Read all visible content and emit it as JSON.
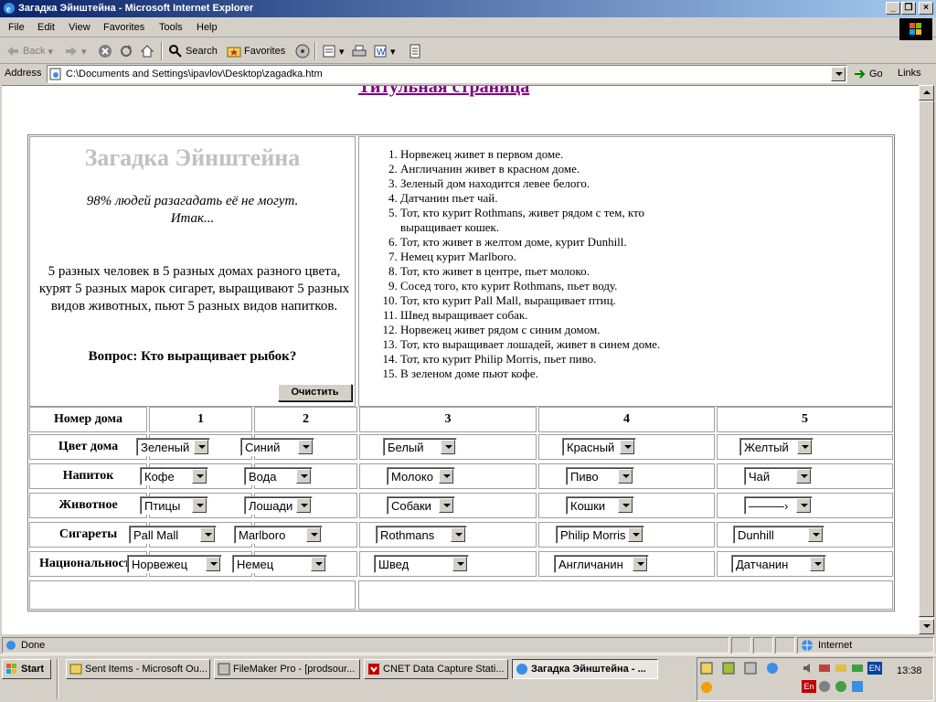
{
  "window": {
    "title": "Загадка Эйнштейна - Microsoft Internet Explorer"
  },
  "menu": [
    "File",
    "Edit",
    "View",
    "Favorites",
    "Tools",
    "Help"
  ],
  "toolbar": {
    "back": "Back",
    "search": "Search",
    "favorites": "Favorites"
  },
  "address": {
    "label": "Address",
    "url": "C:\\Documents and Settings\\ipavlov\\Desktop\\zagadka.htm",
    "go": "Go",
    "links": "Links"
  },
  "page": {
    "title_link": "Титульная страница",
    "heading": "Загадка Эйнштейна",
    "tagline1": "98% людей разагадать её не могут.",
    "tagline2": "Итак...",
    "description": "5 разных человек в 5 разных домах разного цвета, курят 5 разных марок сигарет, выращивают 5 разных видов животных, пьют 5 разных видов напитков.",
    "question": "Вопрос: Кто выращивает рыбок?",
    "clear_button": "Очистить",
    "rules": [
      "Норвежец живет в первом доме.",
      "Англичанин живет в красном доме.",
      "Зеленый дом находится левее белого.",
      "Датчанин пьет чай.",
      "Тот, кто курит Rothmans, живет рядом с тем, кто выращивает кошек.",
      "Тот, кто живет в желтом доме, курит Dunhill.",
      "Немец курит Marlboro.",
      "Тот, кто живет в центре, пьет молоко.",
      "Сосед того, кто курит Rothmans, пьет воду.",
      "Тот, кто курит Pall Mall, выращивает птиц.",
      "Швед выращивает собак.",
      "Норвежец живет рядом с синим домом.",
      "Тот, кто выращивает лошадей, живет в синем доме.",
      "Тот, кто курит Philip Morris, пьет пиво.",
      "В зеленом доме пьют кофе."
    ],
    "grid": {
      "header_label": "Номер дома",
      "house_numbers": [
        "1",
        "2",
        "3",
        "4",
        "5"
      ],
      "rows": [
        {
          "label": "Цвет дома",
          "values": [
            "Зеленый",
            "Синий",
            "Белый",
            "Красный",
            "Желтый"
          ]
        },
        {
          "label": "Напиток",
          "values": [
            "Кофе",
            "Вода",
            "Молоко",
            "Пиво",
            "Чай"
          ]
        },
        {
          "label": "Животное",
          "values": [
            "Птицы",
            "Лошади",
            "Собаки",
            "Кошки",
            "———›"
          ]
        },
        {
          "label": "Сигареты",
          "values": [
            "Pall Mall",
            "Marlboro",
            "Rothmans",
            "Philip Morris",
            "Dunhill"
          ]
        },
        {
          "label": "Национальность",
          "values": [
            "Норвежец",
            "Немец",
            "Швед",
            "Англичанин",
            "Датчанин"
          ]
        }
      ]
    }
  },
  "status": {
    "text": "Done",
    "zone": "Internet"
  },
  "taskbar": {
    "start": "Start",
    "tasks": [
      "Sent Items - Microsoft Ou...",
      "FileMaker Pro - [prodsour...",
      "CNET Data Capture Stati...",
      "Загадка Эйнштейна - ..."
    ],
    "lang": "EN",
    "lang2": "En",
    "clock": "13:38"
  }
}
